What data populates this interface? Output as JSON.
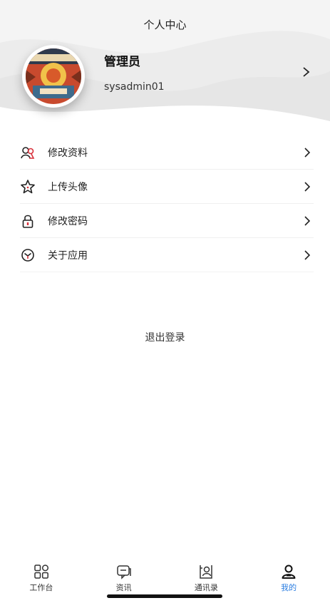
{
  "header": {
    "title": "个人中心"
  },
  "profile": {
    "name": "管理员",
    "account": "sysadmin01",
    "chevron_icon": "chevron-right-icon"
  },
  "menu": {
    "items": [
      {
        "label": "修改资料",
        "icon": "user-edit-icon"
      },
      {
        "label": "上传头像",
        "icon": "star-icon"
      },
      {
        "label": "修改密码",
        "icon": "lock-icon"
      },
      {
        "label": "关于应用",
        "icon": "info-cube-icon"
      }
    ]
  },
  "logout": {
    "label": "退出登录"
  },
  "tabbar": {
    "items": [
      {
        "label": "工作台",
        "icon": "grid-icon",
        "active": false
      },
      {
        "label": "资讯",
        "icon": "chat-icon",
        "active": false
      },
      {
        "label": "通讯录",
        "icon": "contacts-icon",
        "active": false
      },
      {
        "label": "我的",
        "icon": "person-icon",
        "active": true
      }
    ]
  },
  "colors": {
    "accent": "#2a7de1",
    "background": "#ffffff",
    "header_bg": "#f4f4f4",
    "icon_red": "#d9303b"
  }
}
